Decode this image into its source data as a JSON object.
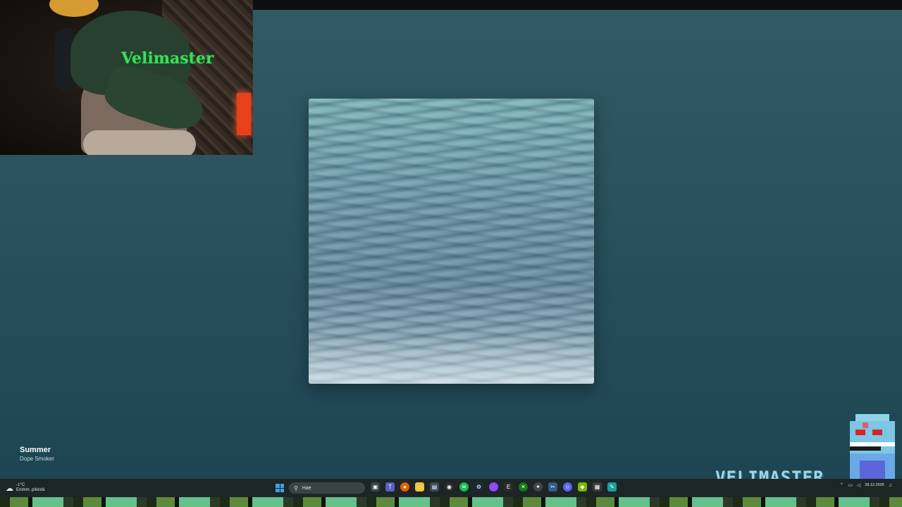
{
  "player": {
    "track_title": "Summer",
    "track_artist": "Dope Smoker"
  },
  "webcam": {
    "cap_text": "Velimaster"
  },
  "overlay": {
    "brand": "VELIMASTER"
  },
  "taskbar": {
    "weather_temp": "-1°C",
    "weather_desc": "Enimm. pilvistä",
    "search_placeholder": "Hae",
    "apps": [
      "task-view-icon",
      "teams-icon",
      "firefox-icon",
      "file-explorer-icon",
      "store-icon",
      "obs-icon",
      "spotify-icon",
      "steam-icon",
      "twitch-icon",
      "epic-games-icon",
      "xbox-icon",
      "settings-icon",
      "snipping-tool-icon",
      "discord-icon",
      "nvidia-icon",
      "calculator-icon",
      "feather-icon"
    ],
    "date": "28.12.2025"
  },
  "colors": {
    "background_top": "#315a65",
    "background_bottom": "#1d4552",
    "accent_spotify": "#1db954"
  }
}
